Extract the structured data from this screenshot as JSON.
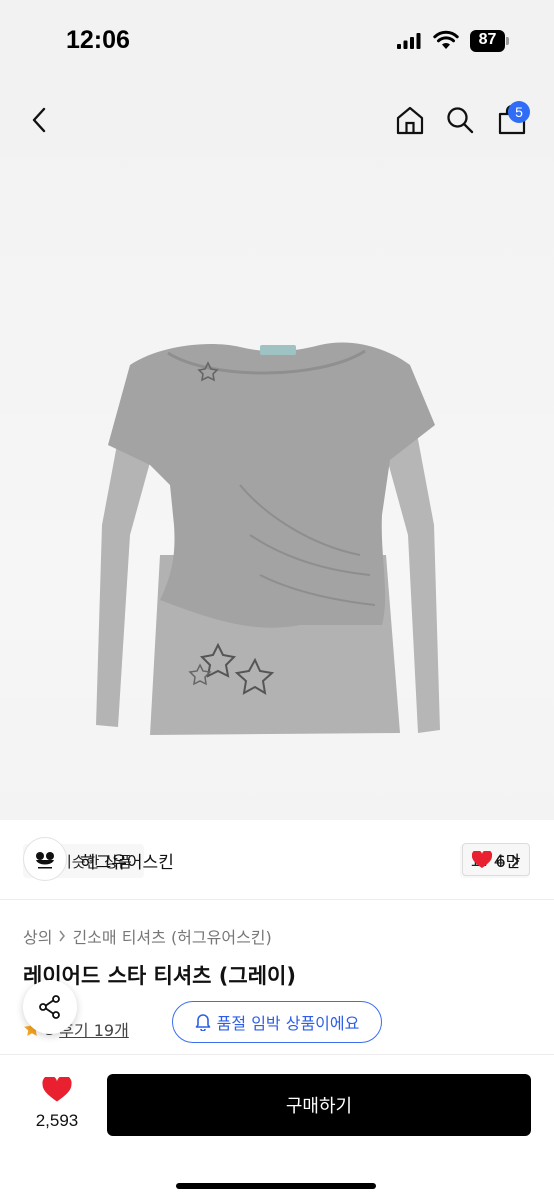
{
  "status_bar": {
    "time": "12:06",
    "battery": "87",
    "icons": [
      "signal-icon",
      "wifi-icon",
      "battery-icon"
    ]
  },
  "header": {
    "icons": [
      "back-icon",
      "home-icon",
      "search-icon",
      "cart-icon"
    ],
    "cart_badge": "5"
  },
  "gallery": {
    "similar_label": "비슷한 상품",
    "pager": "1 / 4"
  },
  "brand": {
    "name": "허그유어스킨",
    "like_count": "6만"
  },
  "product": {
    "breadcrumb": [
      "상의",
      "긴소매 티셔츠 (허그유어스킨)"
    ],
    "title": "레이어드 스타 티셔츠 (그레이)",
    "rating_digit": "5",
    "reviews": "후기 19개",
    "stock_notice": "품절 임박 상품이에요"
  },
  "bottom_bar": {
    "wish_count": "2,593",
    "buy_label": "구매하기"
  },
  "colors": {
    "accent_blue": "#2f6df6",
    "heart_red": "#e8202f",
    "shirt_grey": "#a9a9a9"
  }
}
